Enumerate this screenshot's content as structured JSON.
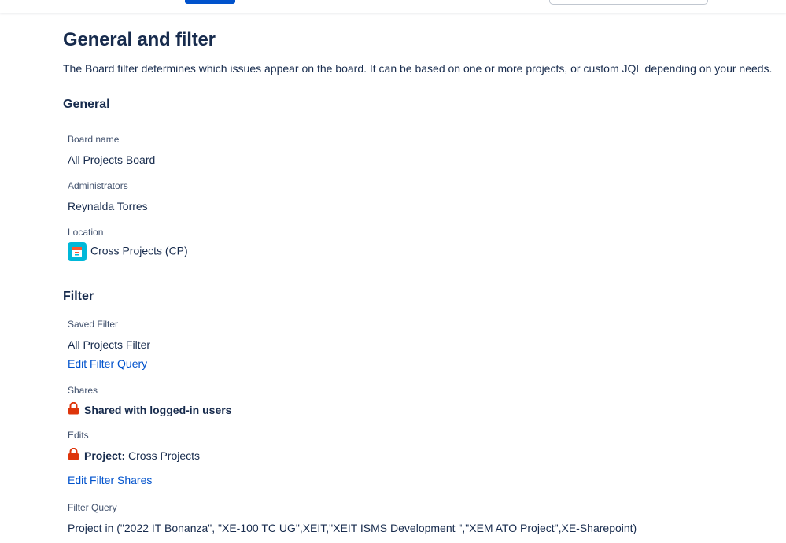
{
  "page": {
    "title": "General and filter",
    "description": "The Board filter determines which issues appear on the board. It can be based on one or more projects, or custom JQL depending on your needs."
  },
  "general": {
    "heading": "General",
    "board_name_label": "Board name",
    "board_name_value": "All Projects Board",
    "administrators_label": "Administrators",
    "administrators_value": "Reynalda Torres",
    "location_label": "Location",
    "location_value": "Cross Projects (CP)",
    "location_icon": "project-avatar-icon"
  },
  "filter": {
    "heading": "Filter",
    "saved_filter_label": "Saved Filter",
    "saved_filter_value": "All Projects Filter",
    "edit_filter_query_link": "Edit Filter Query",
    "shares_label": "Shares",
    "shares_value": "Shared with logged-in users",
    "edits_label": "Edits",
    "edits_prefix": "Project:",
    "edits_value": "Cross Projects",
    "edit_filter_shares_link": "Edit Filter Shares",
    "filter_query_label": "Filter Query",
    "filter_query_value": "Project in (\"2022 IT Bonanza\", \"XE-100 TC UG\",XEIT,\"XEIT ISMS Development \",\"XEM ATO Project\",XE-Sharepoint)"
  },
  "colors": {
    "text": "#172b4d",
    "label": "#42526e",
    "link": "#0052cc",
    "lock": "#de350b",
    "avatar": "#00b8d9"
  }
}
